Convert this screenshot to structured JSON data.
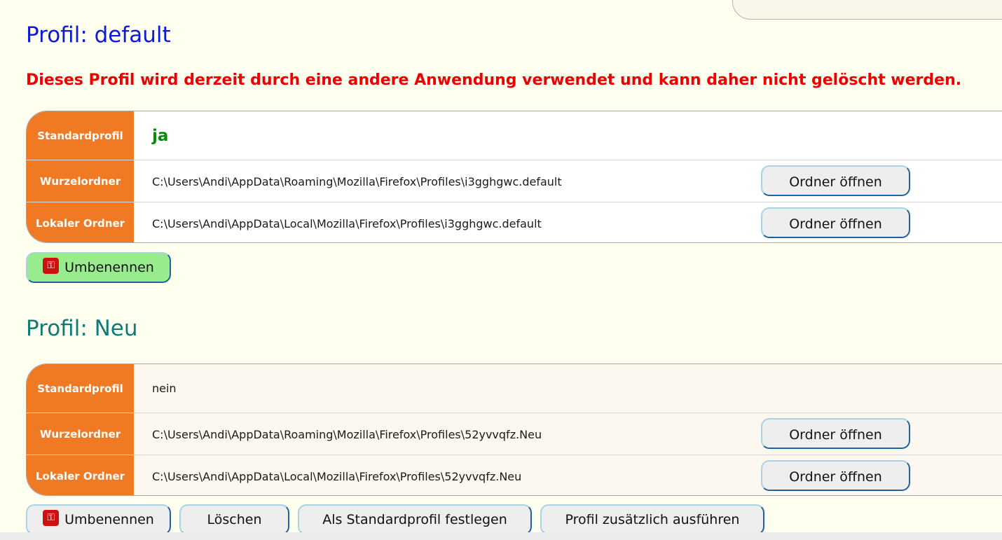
{
  "colors": {
    "page_background": "#fffff0",
    "default_title": "#0b1adb",
    "other_title": "#0e7b76",
    "warning": "#ee0000",
    "label_background": "#f07a24",
    "yes_value": "#0a8a0a",
    "rename_button": "#98ec8e"
  },
  "profiles": [
    {
      "title": "Profil: default",
      "warning": "Dieses Profil wird derzeit durch eine andere Anwendung verwendet und kann daher nicht gelöscht werden.",
      "rows": {
        "standard": {
          "label": "Standardprofil",
          "value": "ja"
        },
        "root": {
          "label": "Wurzelordner",
          "value": "C:\\Users\\Andi\\AppData\\Roaming\\Mozilla\\Firefox\\Profiles\\i3gghgwc.default",
          "button": "Ordner öffnen"
        },
        "local": {
          "label": "Lokaler Ordner",
          "value": "C:\\Users\\Andi\\AppData\\Local\\Mozilla\\Firefox\\Profiles\\i3gghgwc.default",
          "button": "Ordner öffnen"
        }
      },
      "actions": {
        "rename": "Umbenennen",
        "rename_icon": "key-icon"
      }
    },
    {
      "title": "Profil: Neu",
      "rows": {
        "standard": {
          "label": "Standardprofil",
          "value": "nein"
        },
        "root": {
          "label": "Wurzelordner",
          "value": "C:\\Users\\Andi\\AppData\\Roaming\\Mozilla\\Firefox\\Profiles\\52yvvqfz.Neu",
          "button": "Ordner öffnen"
        },
        "local": {
          "label": "Lokaler Ordner",
          "value": "C:\\Users\\Andi\\AppData\\Local\\Mozilla\\Firefox\\Profiles\\52yvvqfz.Neu",
          "button": "Ordner öffnen"
        }
      },
      "actions": {
        "rename": "Umbenennen",
        "rename_icon": "key-icon",
        "delete": "Löschen",
        "set_default": "Als Standardprofil festlegen",
        "run_additionally": "Profil zusätzlich ausführen"
      }
    }
  ]
}
